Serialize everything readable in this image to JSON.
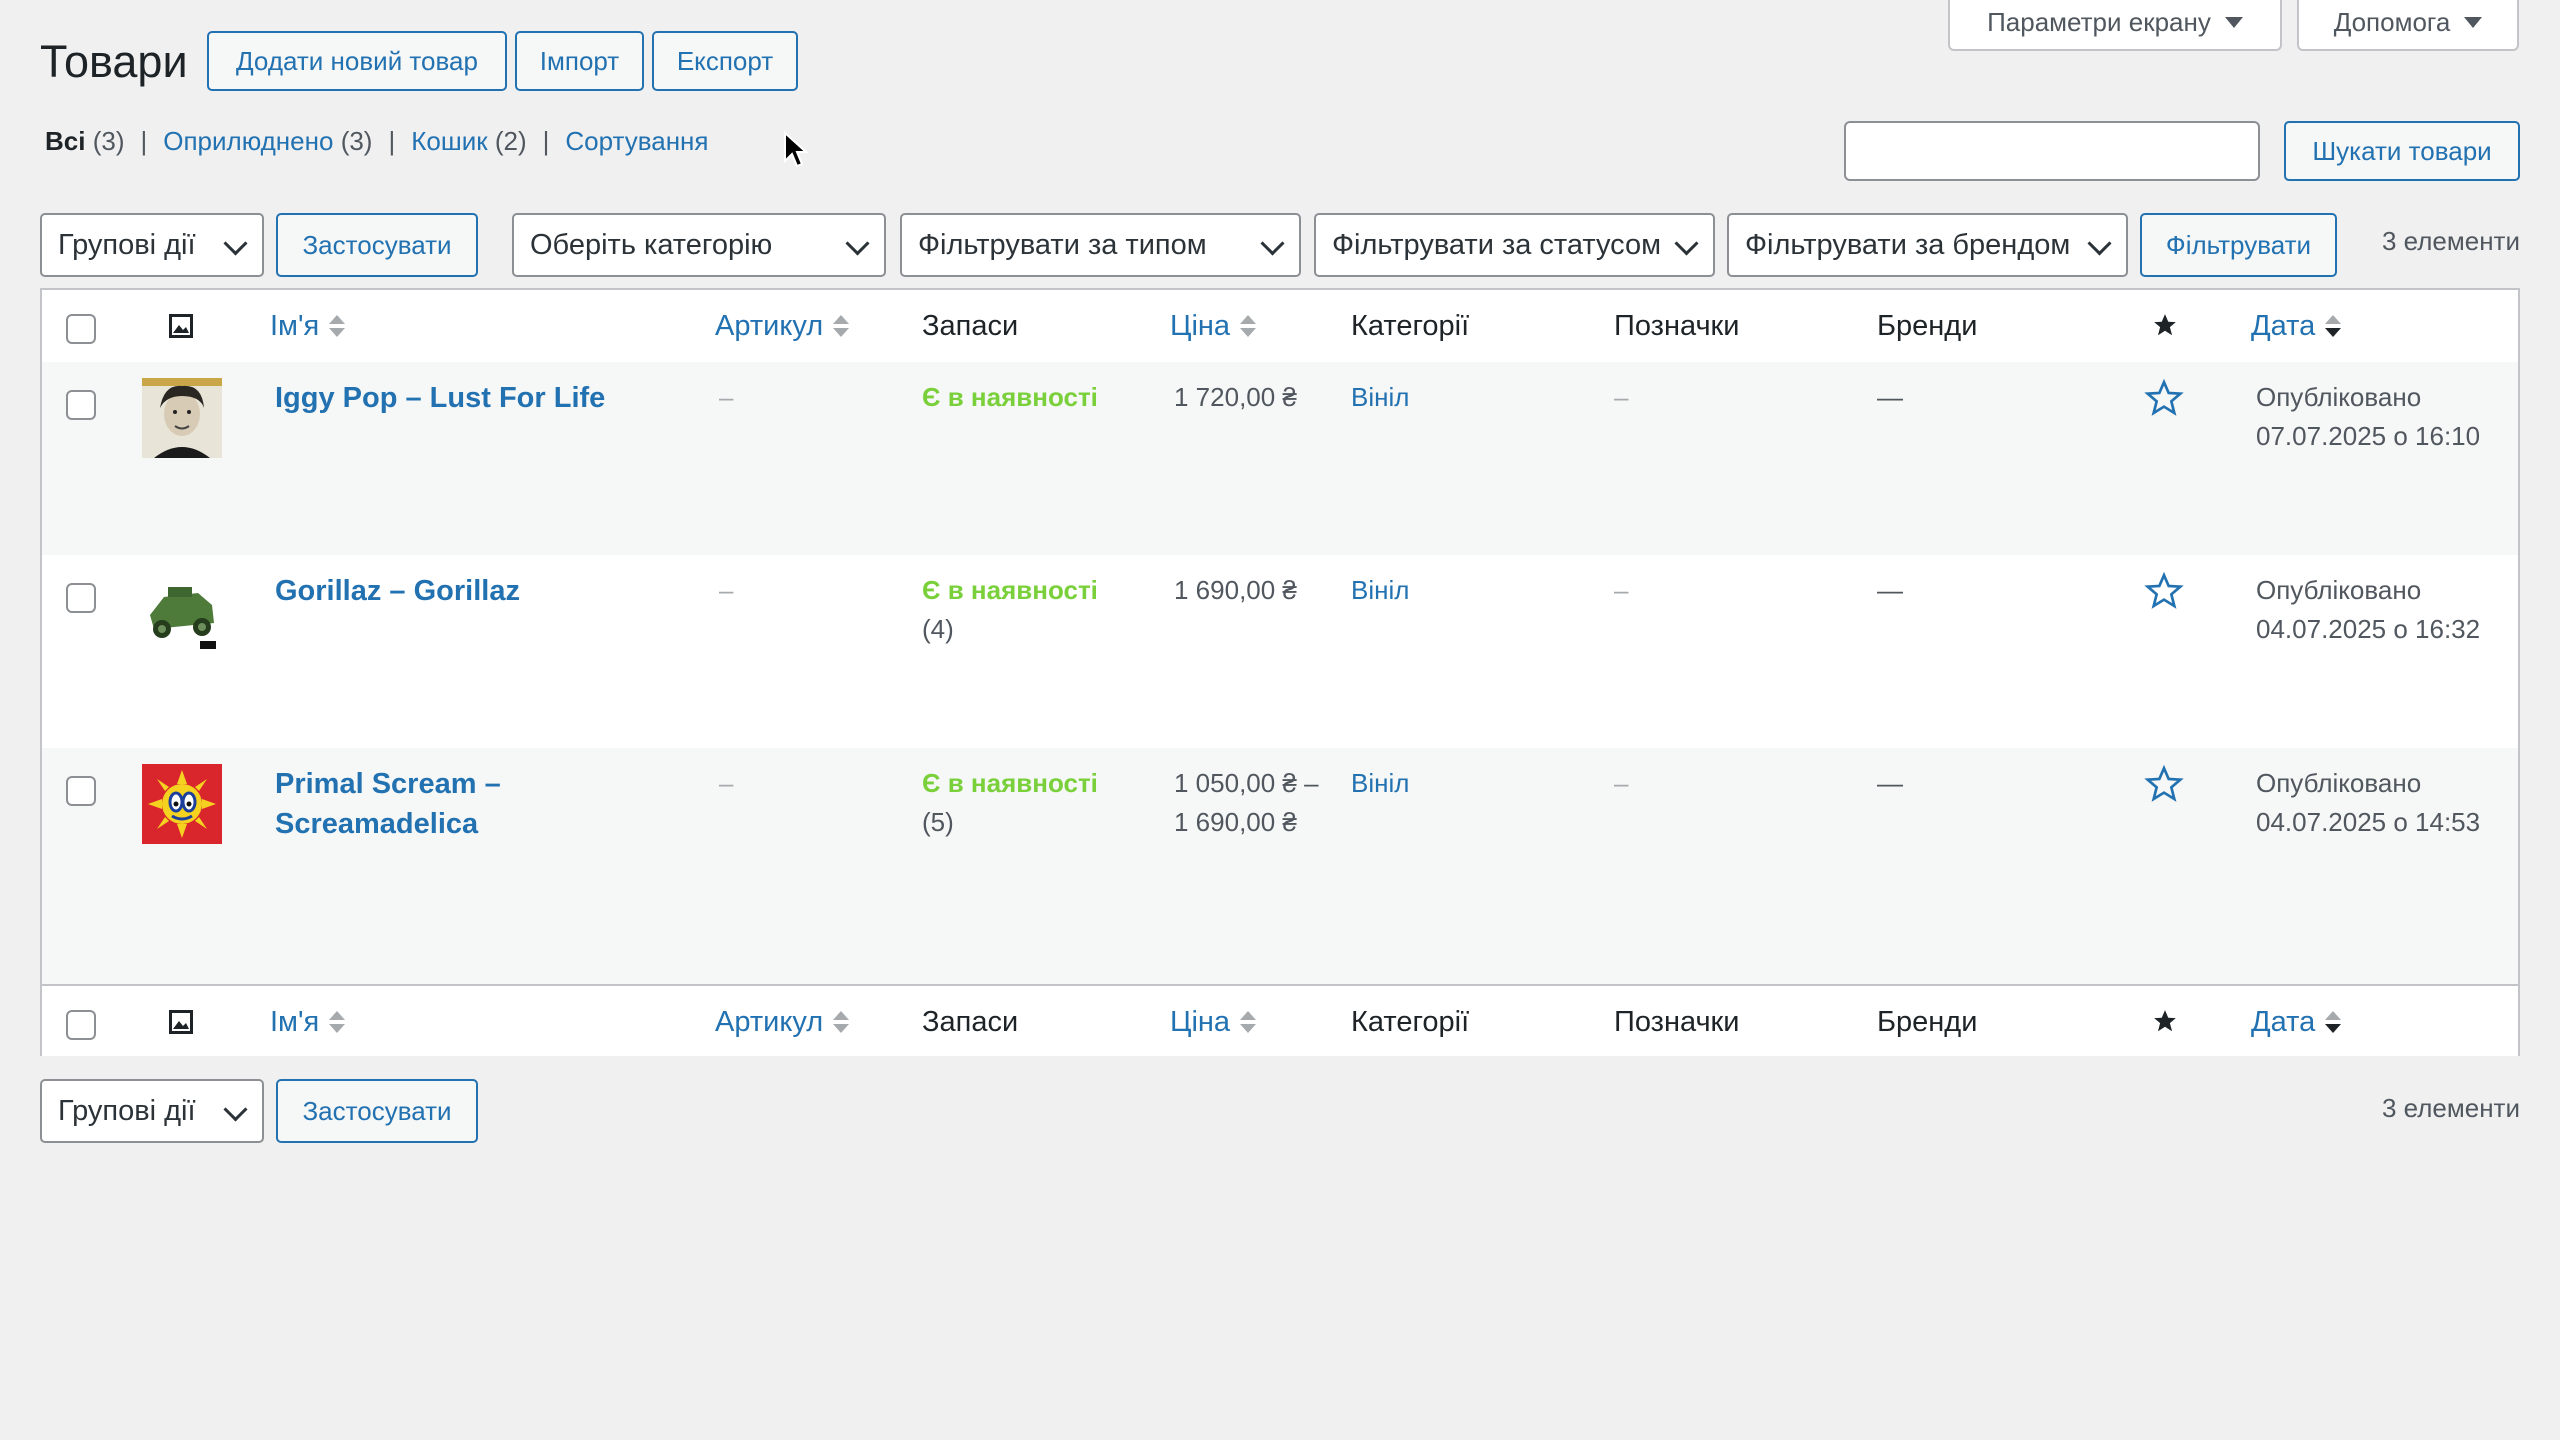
{
  "header": {
    "title": "Товари",
    "add_new": "Додати новий товар",
    "import": "Імпорт",
    "export": "Експорт",
    "screen_options": "Параметри екрану",
    "help": "Допомога"
  },
  "views": [
    {
      "label": "Всі",
      "count": "(3)"
    },
    {
      "label": "Оприлюднено",
      "count": "(3)"
    },
    {
      "label": "Кошик",
      "count": "(2)"
    },
    {
      "label": "Сортування",
      "count": ""
    }
  ],
  "search": {
    "value": "",
    "button": "Шукати товари"
  },
  "filters": {
    "bulk_actions": "Групові дії",
    "apply": "Застосувати",
    "category": "Оберіть категорію",
    "type": "Фільтрувати за типом",
    "status": "Фільтрувати за статусом",
    "brand": "Фільтрувати за брендом",
    "filter_button": "Фільтрувати",
    "items_count": "3 елементи"
  },
  "columns": {
    "name": "Ім'я",
    "sku": "Артикул",
    "stock": "Запаси",
    "price": "Ціна",
    "categories": "Категорії",
    "tags": "Позначки",
    "brands": "Бренди",
    "date": "Дата"
  },
  "rows": [
    {
      "name": "Iggy Pop – Lust For Life",
      "sku": "–",
      "stock": "Є в наявності",
      "stock_count": "",
      "price": "1 720,00 ₴",
      "category": "Вініл",
      "tags": "–",
      "brands": "—",
      "date_status": "Опубліковано",
      "date": "07.07.2025 о 16:10",
      "thumb_icon": "iggy-pop-cover"
    },
    {
      "name": "Gorillaz – Gorillaz",
      "sku": "–",
      "stock": "Є в наявності",
      "stock_count": "(4)",
      "price": "1 690,00 ₴",
      "category": "Вініл",
      "tags": "–",
      "brands": "—",
      "date_status": "Опубліковано",
      "date": "04.07.2025 о 16:32",
      "thumb_icon": "gorillaz-cover"
    },
    {
      "name": "Primal Scream – Screamadelica",
      "sku": "–",
      "stock": "Є в наявності",
      "stock_count": "(5)",
      "price": "1 050,00 ₴ – 1 690,00 ₴",
      "category": "Вініл",
      "tags": "–",
      "brands": "—",
      "date_status": "Опубліковано",
      "date": "04.07.2025 о 14:53",
      "thumb_icon": "screamadelica-cover"
    }
  ],
  "colors": {
    "link": "#2271b1",
    "instock": "#7ad03a",
    "border": "#c3c4c7"
  }
}
